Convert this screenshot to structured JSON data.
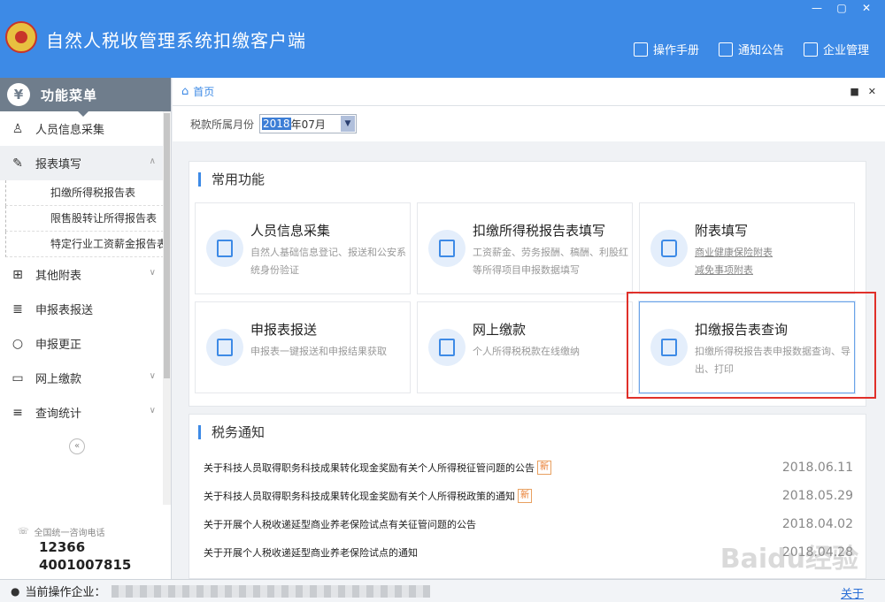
{
  "app": {
    "title": "自然人税收管理系统扣缴客户端",
    "window_controls": [
      "—",
      "▢",
      "✕"
    ]
  },
  "top_nav": [
    {
      "label": "操作手册",
      "icon": "manual-icon"
    },
    {
      "label": "通知公告",
      "icon": "mail-icon"
    },
    {
      "label": "企业管理",
      "icon": "building-icon"
    }
  ],
  "sidebar": {
    "title": "功能菜单",
    "yen_symbol": "¥",
    "items": [
      {
        "label": "人员信息采集",
        "icon": "person-icon"
      },
      {
        "label": "报表填写",
        "icon": "edit-icon",
        "active": true
      },
      {
        "label": "其他附表",
        "icon": "grid-icon"
      },
      {
        "label": "申报表报送",
        "icon": "report-icon"
      },
      {
        "label": "申报更正",
        "icon": "search-icon"
      },
      {
        "label": "网上缴款",
        "icon": "card-icon"
      },
      {
        "label": "查询统计",
        "icon": "query-icon"
      }
    ],
    "submenu": [
      "扣缴所得税报告表",
      "限售股转让所得报告表",
      "特定行业工资薪金报告表"
    ],
    "collapse": "«",
    "hotline_label": "全国统一咨询电话",
    "hotlines": [
      "12366",
      "4001007815"
    ]
  },
  "breadcrumb": {
    "home": "首页"
  },
  "filter": {
    "label": "税款所属月份",
    "month_selected": "2018",
    "month_rest": "年07月",
    "arrow": "▼"
  },
  "common": {
    "title": "常用功能",
    "cards": [
      {
        "title": "人员信息采集",
        "desc": "自然人基础信息登记、报送和公安系统身份验证"
      },
      {
        "title": "扣缴所得税报告表填写",
        "desc": "工资薪金、劳务报酬、稿酬、利股红等所得项目申报数据填写"
      },
      {
        "title": "附表填写",
        "links": [
          "商业健康保险附表",
          "减免事项附表"
        ]
      },
      {
        "title": "申报表报送",
        "desc": "申报表一键报送和申报结果获取"
      },
      {
        "title": "网上缴款",
        "desc": "个人所得税税款在线缴纳"
      },
      {
        "title": "扣缴报告表查询",
        "desc": "扣缴所得税报告表申报数据查询、导出、打印"
      }
    ]
  },
  "notices": {
    "title": "税务通知",
    "new_label": "新",
    "items": [
      {
        "title": "关于科技人员取得职务科技成果转化现金奖励有关个人所得税征管问题的公告",
        "date": "2018.06.11",
        "new": true
      },
      {
        "title": "关于科技人员取得职务科技成果转化现金奖励有关个人所得税政策的通知",
        "date": "2018.05.29",
        "new": true
      },
      {
        "title": "关于开展个人税收递延型商业养老保险试点有关征管问题的公告",
        "date": "2018.04.02",
        "new": false
      },
      {
        "title": "关于开展个人税收递延型商业养老保险试点的通知",
        "date": "2018.04.28",
        "new": false
      }
    ]
  },
  "status": {
    "label": "当前操作企业：",
    "about": "关于"
  },
  "watermark": "Baidu经验"
}
